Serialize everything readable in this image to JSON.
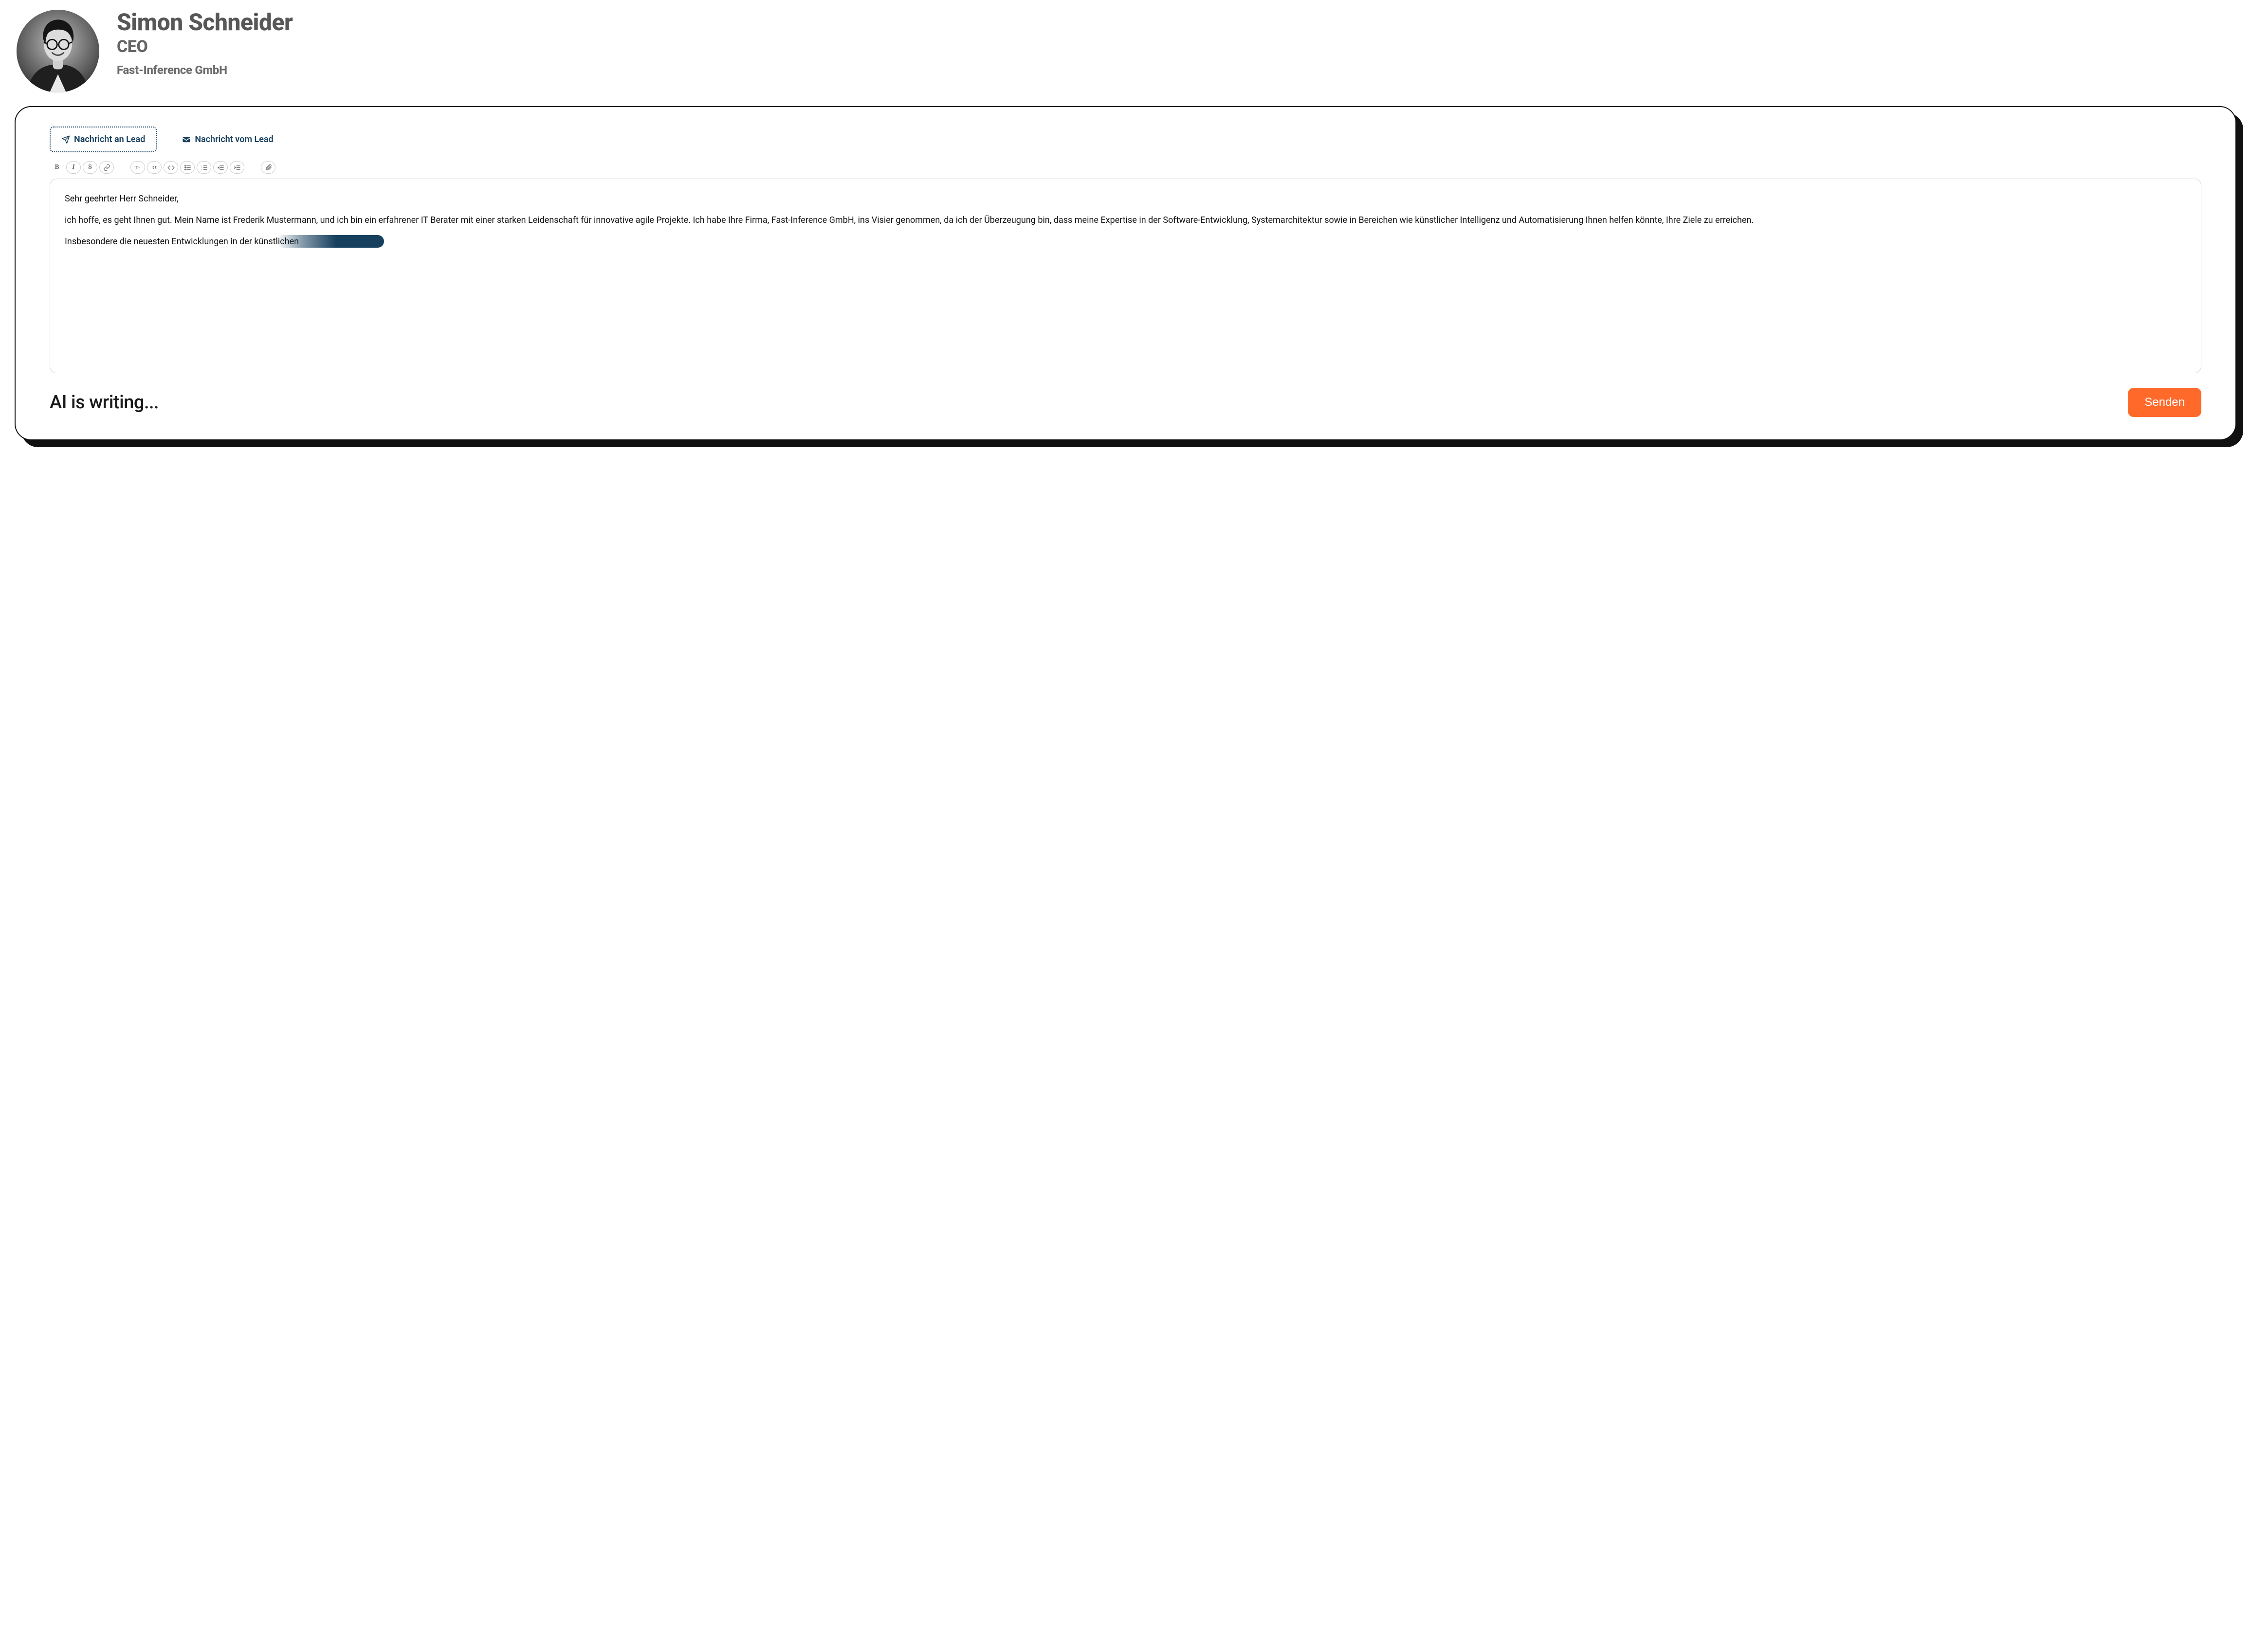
{
  "lead": {
    "name": "Simon Schneider",
    "role": "CEO",
    "company": "Fast-Inference GmbH"
  },
  "tabs": {
    "to_lead": "Nachricht an Lead",
    "from_lead": "Nachricht vom Lead"
  },
  "toolbar_icons": {
    "bold": "bold",
    "italic": "italic",
    "strike": "strikethrough",
    "link": "link",
    "textsize": "text-size",
    "quote": "blockquote",
    "code": "code",
    "ul": "unordered-list",
    "ol": "ordered-list",
    "outdent": "outdent",
    "indent": "indent",
    "attach": "attachment"
  },
  "message": {
    "greeting": "Sehr geehrter Herr Schneider,",
    "body": "ich hoffe, es geht Ihnen gut. Mein Name ist Frederik Mustermann, und ich bin ein erfahrener IT Berater mit einer starken Leidenschaft für innovative agile Projekte. Ich habe Ihre Firma, Fast-Inference GmbH, ins Visier genommen, da ich der Überzeugung bin, dass meine Expertise in der Software-Entwicklung, Systemarchitektur sowie in Bereichen wie künstlicher Intelligenz und Automatisierung Ihnen helfen könnte, Ihre Ziele zu erreichen.",
    "typing_prefix": "Insbesondere die neuesten Entwicklungen in der künstlichen"
  },
  "footer": {
    "ai_status": "AI is writing...",
    "send_label": "Senden"
  },
  "colors": {
    "accent_dark": "#17405f",
    "accent_orange": "#ff6a2b",
    "text_muted": "#5f5f5f"
  }
}
